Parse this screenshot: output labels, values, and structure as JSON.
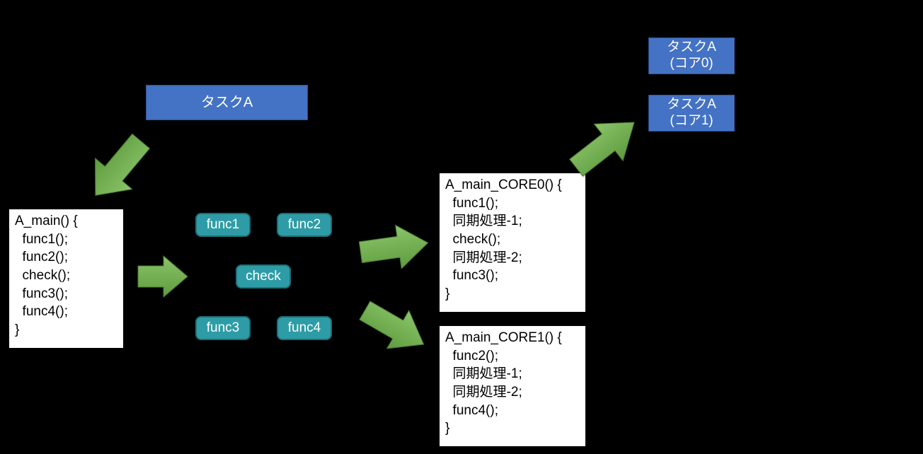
{
  "task_a": "タスクA",
  "task_a_core0_l1": "タスクA",
  "task_a_core0_l2": "(コア0)",
  "task_a_core1_l1": "タスクA",
  "task_a_core1_l2": "(コア1)",
  "code_main": "A_main() {\n  func1();\n  func2();\n  check();\n  func3();\n  func4();\n}",
  "code_core0": "A_main_CORE0() {\n  func1();\n  同期処理-1;\n  check();\n  同期処理-2;\n  func3();\n}",
  "code_core1": "A_main_CORE1() {\n  func2();\n  同期処理-1;\n  同期処理-2;\n  func4();\n}",
  "funcs": {
    "f1": "func1",
    "f2": "func2",
    "f3": "func3",
    "f4": "func4",
    "check": "check"
  },
  "colors": {
    "task_bg": "#4472c4",
    "func_bg": "#2e9ca6",
    "arrow": "#70ad47"
  }
}
